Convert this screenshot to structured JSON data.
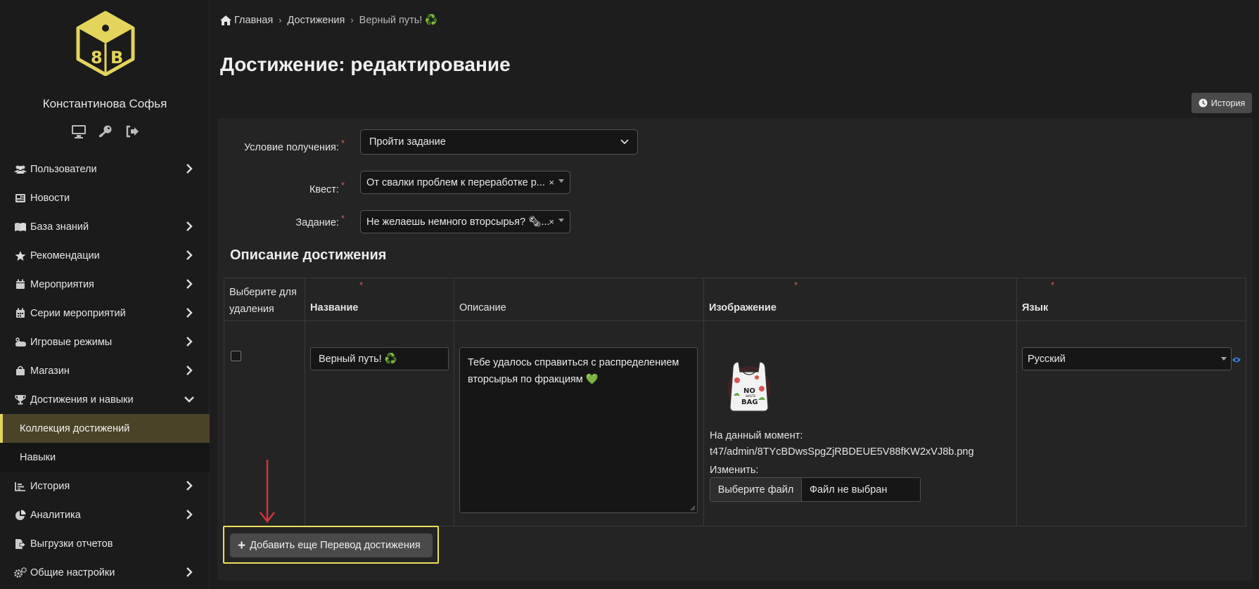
{
  "sidebar": {
    "user_name": "Константинова Софья",
    "user_icons": [
      "monitor-icon",
      "key-icon",
      "sign-out-icon"
    ],
    "items": [
      {
        "label": "Пользователи",
        "icon": "users-icon",
        "has_children": true
      },
      {
        "label": "Новости",
        "icon": "newspaper-icon",
        "has_children": false
      },
      {
        "label": "База знаний",
        "icon": "book-icon",
        "has_children": true
      },
      {
        "label": "Рекомендации",
        "icon": "star-icon",
        "has_children": true
      },
      {
        "label": "Мероприятия",
        "icon": "calendar-icon",
        "has_children": true
      },
      {
        "label": "Серии мероприятий",
        "icon": "calendar-grid-icon",
        "has_children": true
      },
      {
        "label": "Игровые режимы",
        "icon": "gamepad-icon",
        "has_children": true
      },
      {
        "label": "Магазин",
        "icon": "shopping-bag-icon",
        "has_children": true
      },
      {
        "label": "Достижения и навыки",
        "icon": "trophy-icon",
        "has_children": true,
        "expanded": true
      },
      {
        "label": "История",
        "icon": "chart-bar-icon",
        "has_children": true
      },
      {
        "label": "Аналитика",
        "icon": "pie-chart-icon",
        "has_children": true
      },
      {
        "label": "Выгрузки отчетов",
        "icon": "file-export-icon",
        "has_children": false
      },
      {
        "label": "Общие настройки",
        "icon": "cogs-icon",
        "has_children": true
      }
    ],
    "sub_items": [
      {
        "label": "Коллекция достижений",
        "active": true
      },
      {
        "label": "Навыки",
        "active": false
      }
    ]
  },
  "breadcrumb": {
    "home": "Главная",
    "section": "Достижения",
    "current": "Верный путь! ♻️"
  },
  "page_title": "Достижение: редактирование",
  "history_button": "История",
  "form": {
    "condition_label": "Условие получения:",
    "condition_value": "Пройти задание",
    "quest_label": "Квест:",
    "quest_value": "От свалки проблем к переработке р...",
    "task_label": "Задание:",
    "task_value": "Не желаешь немного вторсырья? 🗞...",
    "clear_symbol": "×"
  },
  "section_title": "Описание достижения",
  "table": {
    "headers": {
      "delete": "Выберите для удаления",
      "name": "Название",
      "description": "Описание",
      "image": "Изображение",
      "language": "Язык"
    },
    "row": {
      "name": "Верный путь! ♻️",
      "description": "Тебе удалось справиться с распределением вторсырья по фракциям 💚",
      "image_current_label": "На данный момент:",
      "image_file": "t47/admin/8TYcBDwsSpgZjRBDEUE5V88fKW2xVJ8b.png",
      "image_change_label": "Изменить:",
      "file_button": "Выберите файл",
      "file_status": "Файл не выбран",
      "image_text_top": "NO",
      "image_text_mid": "WASTE",
      "image_text_bot": "BAG",
      "language": "Русский"
    }
  },
  "add_button": "Добавить еще Перевод достижения",
  "colors": {
    "accent": "#e3d45c",
    "active_bg": "#4a4328",
    "required": "#e05858",
    "arrow": "#d0343c"
  }
}
